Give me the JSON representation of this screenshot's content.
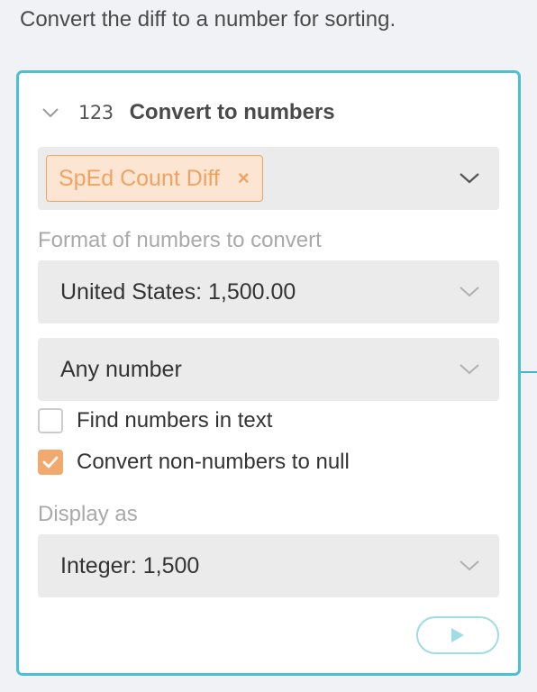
{
  "instruction": "Convert the diff to a number for sorting.",
  "step": {
    "icon_text": "123",
    "title": "Convert to numbers"
  },
  "columns": {
    "selected": [
      {
        "label": "SpEd Count Diff",
        "remove": "×"
      }
    ]
  },
  "format": {
    "label": "Format of numbers to convert",
    "locale_value": "United States: 1,500.00",
    "extract_value": "Any number"
  },
  "options": {
    "find_in_text": {
      "label": "Find numbers in text",
      "checked": false
    },
    "non_numbers_null": {
      "label": "Convert non-numbers to null",
      "checked": true
    }
  },
  "display": {
    "label": "Display as",
    "value": "Integer: 1,500"
  },
  "colors": {
    "accent": "#4cc0d3",
    "tag": "#f0a262",
    "checked": "#f2a96d"
  }
}
